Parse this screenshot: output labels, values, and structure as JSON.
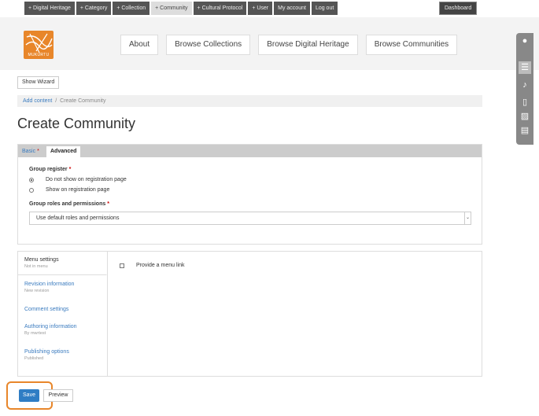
{
  "admin_menu": [
    "+ Digital Heritage",
    "+ Category",
    "+ Collection",
    "+ Community",
    "+ Cultural Protocol",
    "+ User",
    "My account",
    "Log out"
  ],
  "admin_active": "+ Community",
  "dashboard_label": "Dashboard",
  "logo_text": "MUKURTU",
  "nav": [
    "About",
    "Browse Collections",
    "Browse Digital Heritage",
    "Browse Communities"
  ],
  "wizard_label": "Show Wizard",
  "breadcrumb": {
    "link": "Add content",
    "separator": "/",
    "current": "Create Community"
  },
  "page_title": "Create Community",
  "tabs": {
    "basic": "Basic",
    "basic_marker": "*",
    "advanced": "Advanced"
  },
  "group_register": {
    "label": "Group register",
    "required": "*",
    "options": [
      "Do not show on registration page",
      "Show on registration page"
    ],
    "selected": 0
  },
  "group_roles": {
    "label": "Group roles and permissions",
    "required": "*",
    "value": "Use default roles and permissions"
  },
  "vertical_tabs": [
    {
      "title": "Menu settings",
      "summary": "Not in menu"
    },
    {
      "title": "Revision information",
      "summary": "New revision"
    },
    {
      "title": "Comment settings",
      "summary": ""
    },
    {
      "title": "Authoring information",
      "summary": "By mwrtest"
    },
    {
      "title": "Publishing options",
      "summary": "Published"
    }
  ],
  "menu_link_label": "Provide a menu link",
  "buttons": {
    "save": "Save",
    "preview": "Preview"
  },
  "colors": {
    "accent": "#e8862a",
    "link": "#3a7bbf",
    "primary": "#2f7dc4"
  }
}
